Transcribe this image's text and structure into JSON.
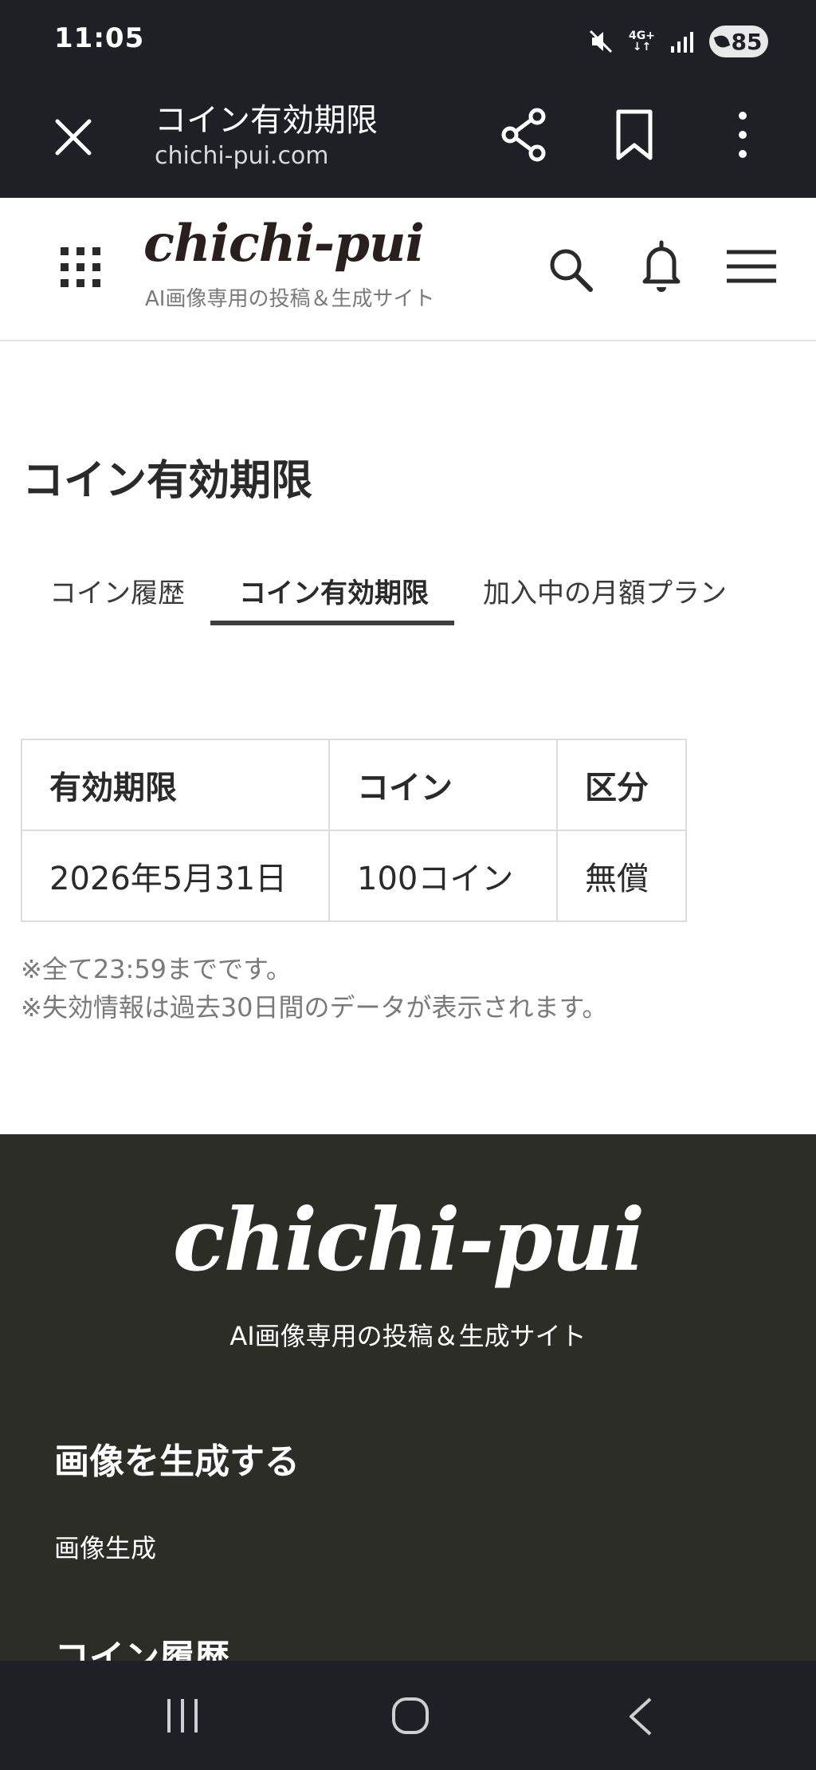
{
  "status_bar": {
    "time": "11:05",
    "network": "4G+",
    "battery": "85"
  },
  "browser": {
    "title": "コイン有効期限",
    "url": "chichi-pui.com"
  },
  "site_header": {
    "logo": "chichi-pui",
    "tagline": "AI画像専用の投稿＆生成サイト"
  },
  "main": {
    "page_title": "コイン有効期限",
    "tabs": [
      {
        "label": "コイン履歴",
        "active": false
      },
      {
        "label": "コイン有効期限",
        "active": true
      },
      {
        "label": "加入中の月額プラン",
        "active": false
      }
    ],
    "table": {
      "headers": [
        "有効期限",
        "コイン",
        "区分"
      ],
      "rows": [
        [
          "2026年5月31日",
          "100コイン",
          "無償"
        ]
      ]
    },
    "notes": [
      "※全て23:59までです。",
      "※失効情報は過去30日間のデータが表示されます。"
    ]
  },
  "footer": {
    "logo": "chichi-pui",
    "tagline": "AI画像専用の投稿＆生成サイト",
    "section1_title": "画像を生成する",
    "section1_link": "画像生成",
    "section2_title": "コイン履歴"
  },
  "colors": {
    "bar_dark": "#1f2026",
    "footer_bg": "#2c2d27",
    "text": "#2a2a2a",
    "muted": "#7a7a7a"
  }
}
